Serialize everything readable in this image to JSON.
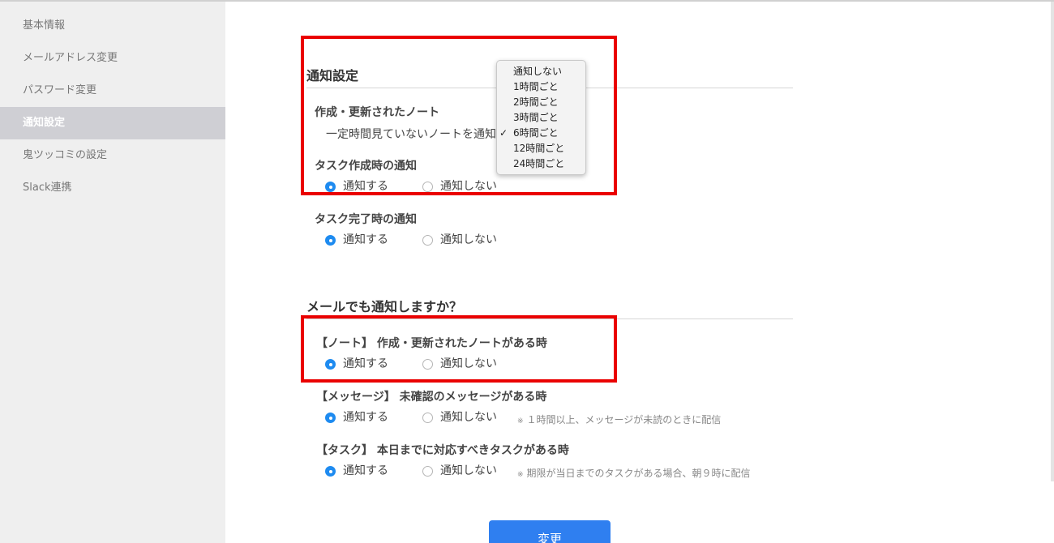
{
  "sidebar": {
    "items": [
      {
        "label": "基本情報"
      },
      {
        "label": "メールアドレス変更"
      },
      {
        "label": "パスワード変更"
      },
      {
        "label": "通知設定",
        "active": true
      },
      {
        "label": "鬼ツッコミの設定"
      },
      {
        "label": "Slack連携"
      }
    ]
  },
  "notification": {
    "title": "通知設定",
    "note_update": {
      "label": "作成・更新されたノート",
      "sub_label": "一定時間見ていないノートを通知",
      "dropdown": {
        "selected": "6時間ごと",
        "options": [
          "通知しない",
          "1時間ごと",
          "2時間ごと",
          "3時間ごと",
          "6時間ごと",
          "12時間ごと",
          "24時間ごと"
        ]
      }
    },
    "task_create": {
      "label": "タスク作成時の通知",
      "on": "通知する",
      "off": "通知しない",
      "selected": "on"
    },
    "task_complete": {
      "label": "タスク完了時の通知",
      "on": "通知する",
      "off": "通知しない",
      "selected": "on"
    }
  },
  "email": {
    "title": "メールでも通知しますか？",
    "note": {
      "label": "【ノート】 作成・更新されたノートがある時",
      "on": "通知する",
      "off": "通知しない",
      "selected": "on"
    },
    "message": {
      "label": "【メッセージ】 未確認のメッセージがある時",
      "on": "通知する",
      "off": "通知しない",
      "selected": "on",
      "note_mark": "※",
      "note": "１時間以上、メッセージが未読のときに配信"
    },
    "task": {
      "label": "【タスク】 本日までに対応すべきタスクがある時",
      "on": "通知する",
      "off": "通知しない",
      "selected": "on",
      "note_mark": "※",
      "note": "期限が当日までのタスクがある場合、朝９時に配信"
    }
  },
  "submit_label": "変更",
  "colors": {
    "accent": "#1e8bf0",
    "button": "#2f7ff0",
    "highlight": "#ea0000",
    "sidebar_bg": "#efefef",
    "sidebar_active": "#cfcfd4"
  }
}
